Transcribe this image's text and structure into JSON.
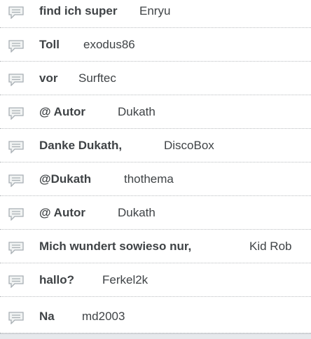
{
  "comments": [
    {
      "title": "find ich super",
      "author": "Enryu",
      "icon": "comment-icon"
    },
    {
      "title": "Toll",
      "author": "exodus86",
      "icon": "comment-icon"
    },
    {
      "title": "vor",
      "author": "Surftec",
      "icon": "comment-icon"
    },
    {
      "title": "@ Autor",
      "author": "Dukath",
      "icon": "comment-icon"
    },
    {
      "title": "Danke Dukath,",
      "author": "DiscoBox",
      "icon": "comment-icon"
    },
    {
      "title": "@Dukath",
      "author": "thothema",
      "icon": "comment-icon"
    },
    {
      "title": "@ Autor",
      "author": "Dukath",
      "icon": "comment-icon"
    },
    {
      "title": "Mich wundert sowieso nur,",
      "author": "Kid Rob",
      "icon": "comment-icon"
    },
    {
      "title": "hallo?",
      "author": "Ferkel2k",
      "icon": "comment-icon"
    },
    {
      "title": "Na",
      "author": "md2003",
      "icon": "comment-icon"
    }
  ],
  "colors": {
    "text": "#3f4346",
    "icon_fill": "#f1f3f3",
    "icon_stroke": "#a7aeb3",
    "divider": "#b9bcbf"
  }
}
